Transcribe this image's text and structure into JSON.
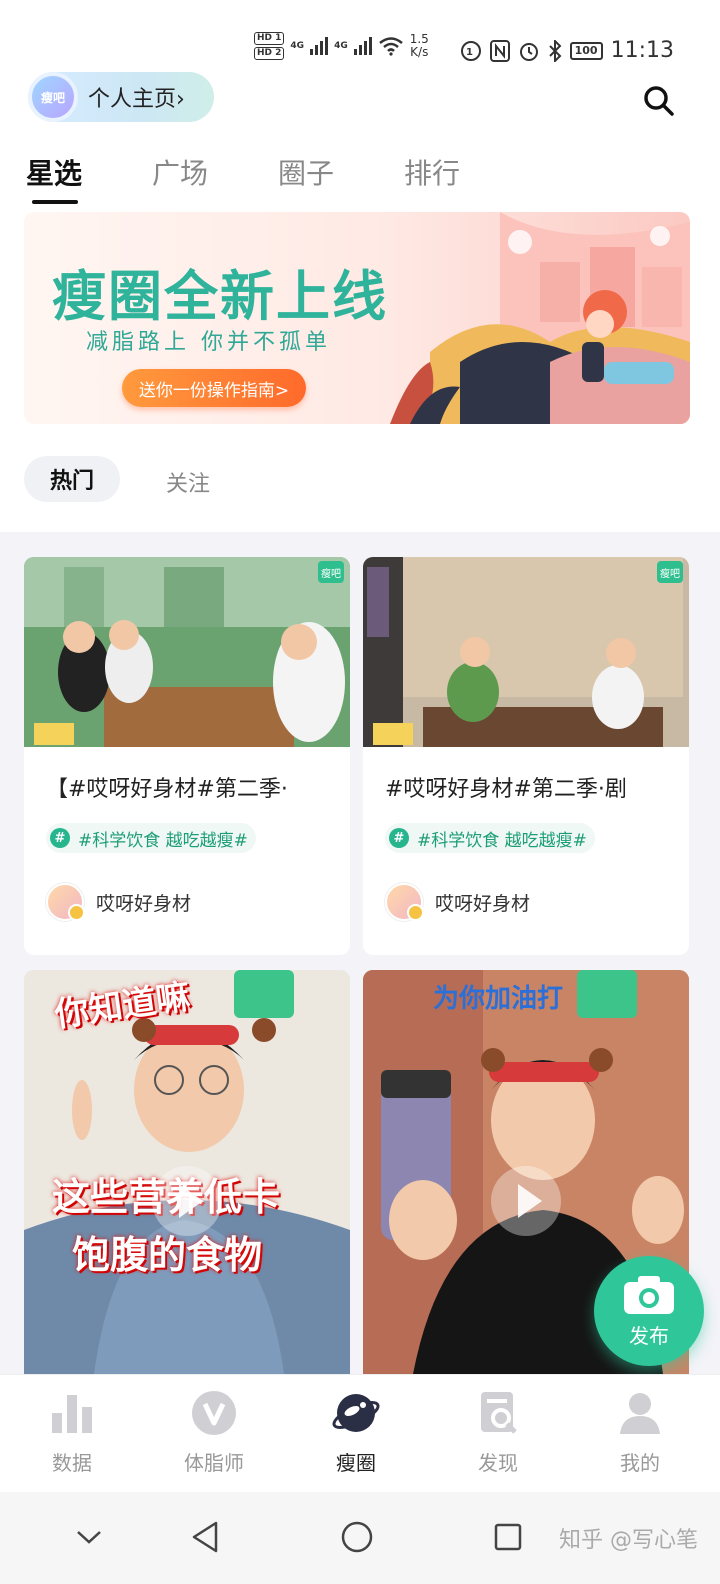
{
  "status_bar": {
    "hd1": "HD 1",
    "hd2": "HD 2",
    "net1": "4G",
    "net2": "4G",
    "speed_value": "1.5",
    "speed_unit": "K/s",
    "battery": "100",
    "time": "11:13"
  },
  "header": {
    "logo_text": "瘦吧",
    "profile_label": "个人主页",
    "chevron": "›"
  },
  "tabs": [
    {
      "label": "星选",
      "active": true
    },
    {
      "label": "广场",
      "active": false
    },
    {
      "label": "圈子",
      "active": false
    },
    {
      "label": "排行",
      "active": false
    }
  ],
  "banner": {
    "title": "瘦圈全新上线",
    "subtitle": "减脂路上  你并不孤单",
    "button": "送你一份操作指南>"
  },
  "filters": {
    "hot": "热门",
    "follow": "关注"
  },
  "cards": [
    {
      "title": "【#哎呀好身材#第二季·",
      "tag": "#科学饮食 越吃越瘦#",
      "author": "哎呀好身材"
    },
    {
      "title": "#哎呀好身材#第二季·剧",
      "tag": "#科学饮食 越吃越瘦#",
      "author": "哎呀好身材"
    }
  ],
  "videos": [
    {
      "caption_top": "你知道嘛",
      "caption_main1": "这些营养低卡",
      "caption_main2": "饱腹的食物"
    },
    {
      "caption_top": "为你加油打"
    }
  ],
  "badge_logo": "瘦吧",
  "fab": {
    "label": "发布"
  },
  "bottom_nav": [
    {
      "label": "数据",
      "icon": "bar-chart-icon",
      "active": false
    },
    {
      "label": "体脂师",
      "icon": "v-circle-icon",
      "active": false
    },
    {
      "label": "瘦圈",
      "icon": "planet-icon",
      "active": true
    },
    {
      "label": "发现",
      "icon": "discover-doc-icon",
      "active": false
    },
    {
      "label": "我的",
      "icon": "person-icon",
      "active": false
    }
  ],
  "watermark": "知乎 @写心笔",
  "colors": {
    "accent_green": "#2fc79a",
    "banner_title": "#2fb39b",
    "banner_button": "#ff6a2b"
  }
}
